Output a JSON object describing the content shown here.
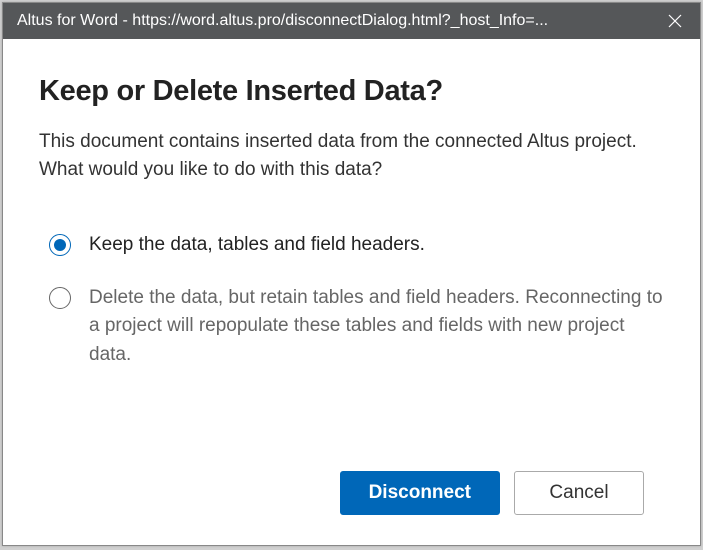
{
  "titlebar": {
    "text": "Altus for Word - https://word.altus.pro/disconnectDialog.html?_host_Info=..."
  },
  "dialog": {
    "title": "Keep or Delete Inserted Data?",
    "description": "This document contains inserted data from the connected Altus project. What would you like to do with this data?"
  },
  "options": {
    "keep": {
      "label": "Keep the data, tables and field headers.",
      "selected": true
    },
    "delete": {
      "label": "Delete the data, but retain tables and field headers. Reconnecting to a project will repopulate these tables and fields with new project data.",
      "selected": false
    }
  },
  "buttons": {
    "primary": "Disconnect",
    "secondary": "Cancel"
  },
  "colors": {
    "accent": "#0067b8",
    "titlebar_bg": "#555759"
  }
}
